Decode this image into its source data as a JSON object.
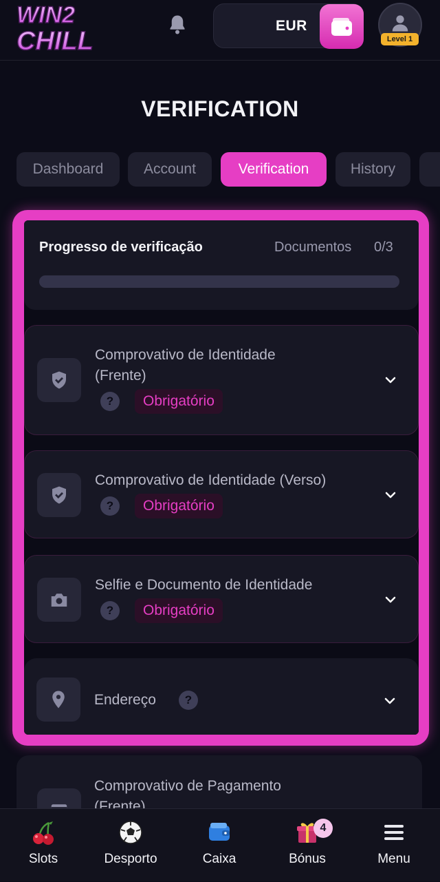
{
  "header": {
    "logo_line1": "WIN2",
    "logo_line2": "CHILL",
    "currency": "EUR",
    "level": "Level 1"
  },
  "page_title": "VERIFICATION",
  "tabs": [
    {
      "label": "Dashboard",
      "active": false
    },
    {
      "label": "Account",
      "active": false
    },
    {
      "label": "Verification",
      "active": true
    },
    {
      "label": "History",
      "active": false
    }
  ],
  "progress": {
    "title": "Progresso de verificação",
    "documents_label": "Documentos",
    "documents_count": "0/3",
    "fraction": 0
  },
  "documents": [
    {
      "title_line1": "Comprovativo de Identidade",
      "title_line2": "(Frente)",
      "help": "?",
      "badge": "Obrigatório",
      "icon": "shield-icon"
    },
    {
      "title": "Comprovativo de Identidade (Verso)",
      "help": "?",
      "badge": "Obrigatório",
      "icon": "shield-icon"
    },
    {
      "title": "Selfie e Documento de Identidade",
      "help": "?",
      "badge": "Obrigatório",
      "icon": "camera-icon"
    },
    {
      "title": "Endereço",
      "help": "?",
      "icon": "location-pin-icon"
    }
  ],
  "extra_document": {
    "title_line1": "Comprovativo de Pagamento",
    "title_line2": "(Frente)",
    "icon": "card-icon"
  },
  "bottom_nav": [
    {
      "label": "Slots",
      "icon": "cherries-icon"
    },
    {
      "label": "Desporto",
      "icon": "soccer-ball-icon"
    },
    {
      "label": "Caixa",
      "icon": "wallet-icon"
    },
    {
      "label": "Bónus",
      "icon": "gift-icon",
      "badge": "4"
    },
    {
      "label": "Menu",
      "icon": "hamburger-menu-icon"
    }
  ],
  "colors": {
    "accent": "#e63ec4",
    "background": "#0c0c18",
    "card": "#171724",
    "level_badge": "#f3b22c"
  }
}
